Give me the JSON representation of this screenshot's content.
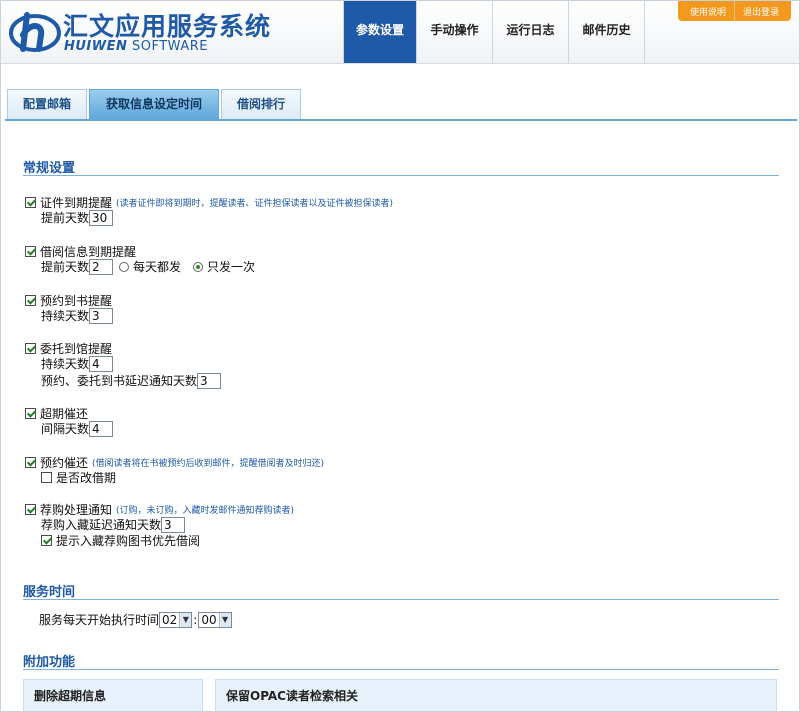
{
  "header": {
    "brand_cn": "汇文应用服务系统",
    "brand_en_bold": "HUIWEN",
    "brand_en": " SOFTWARE",
    "nav": [
      "参数设置",
      "手动操作",
      "运行日志",
      "邮件历史"
    ],
    "top_buttons": [
      "使用说明",
      "退出登录"
    ]
  },
  "tabs": [
    "配置邮箱",
    "获取信息设定时间",
    "借阅排行"
  ],
  "sections": {
    "general": "常规设置",
    "service": "服务时间",
    "extra": "附加功能"
  },
  "settings": {
    "cert": {
      "label": "证件到期提醒",
      "hint": "(读者证件即将到期时，提醒读者、证件担保读者以及证件被担保读者)",
      "days_label": "提前天数",
      "days": "30"
    },
    "loan": {
      "label": "借阅信息到期提醒",
      "days_label": "提前天数",
      "days": "2",
      "opt_daily": "每天都发",
      "opt_once": "只发一次"
    },
    "reserve": {
      "label": "预约到书提醒",
      "days_label": "持续天数",
      "days": "3"
    },
    "entrust": {
      "label": "委托到馆提醒",
      "days_label": "持续天数",
      "days": "4",
      "delay_label": "预约、委托到书延迟通知天数",
      "delay": "3"
    },
    "overdue": {
      "label": "超期催还",
      "days_label": "间隔天数",
      "days": "4"
    },
    "reserve_recall": {
      "label": "预约催还",
      "hint": "(借阅读者将在书被预约后收到邮件，提醒借阅者及时归还)",
      "change_label": "是否改借期"
    },
    "purchase": {
      "label": "荐购处理通知",
      "hint": "(订购，未订购，入藏时发邮件通知荐购读者)",
      "delay_label": "荐购入藏延迟通知天数",
      "delay": "3",
      "priority_label": "提示入藏荐购图书优先借阅"
    }
  },
  "service": {
    "label": "服务每天开始执行时间",
    "hour": "02",
    "minute": "00"
  },
  "panels": [
    "删除超期信息",
    "保留OPAC读者检索相关"
  ],
  "colors": {
    "brand": "#1f5aa6",
    "accent": "#f39a1e",
    "tab_active": "#5ea7d8"
  }
}
